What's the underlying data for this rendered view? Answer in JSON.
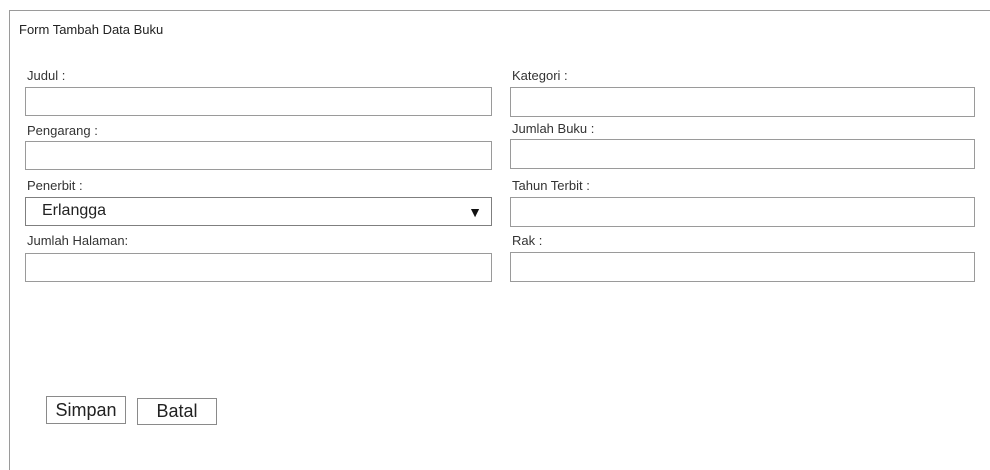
{
  "form": {
    "title": "Form Tambah Data Buku",
    "fields": {
      "judul": {
        "label": "Judul :",
        "value": ""
      },
      "pengarang": {
        "label": "Pengarang :",
        "value": ""
      },
      "penerbit": {
        "label": "Penerbit :",
        "selected": "Erlangga"
      },
      "jumlah_halaman": {
        "label": "Jumlah Halaman:",
        "value": ""
      },
      "kategori": {
        "label": "Kategori :",
        "value": ""
      },
      "jumlah_buku": {
        "label": "Jumlah Buku :",
        "value": ""
      },
      "tahun_terbit": {
        "label": "Tahun Terbit :",
        "value": ""
      },
      "rak": {
        "label": "Rak :",
        "value": ""
      }
    },
    "buttons": {
      "save": "Simpan",
      "cancel": "Batal"
    },
    "icons": {
      "dropdown": "caret-down-icon"
    }
  }
}
